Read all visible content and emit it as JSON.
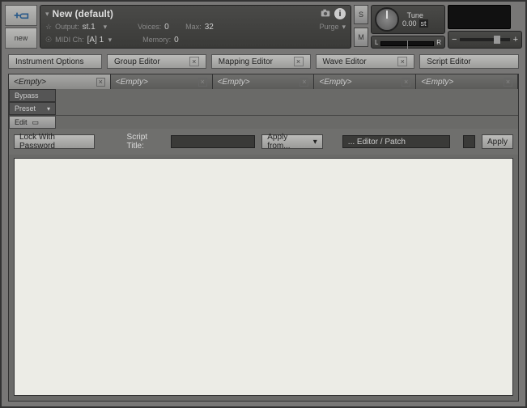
{
  "header": {
    "tool_new_label": "new",
    "title": "New (default)",
    "output_label": "Output:",
    "output_value": "st.1",
    "midi_label": "MIDI Ch:",
    "midi_value": "[A] 1",
    "voices_label": "Voices:",
    "voices_value": "0",
    "voices_max_label": "Max:",
    "voices_max_value": "32",
    "memory_label": "Memory:",
    "memory_value": "0",
    "purge_label": "Purge",
    "s_btn": "S",
    "m_btn": "M",
    "tune_label": "Tune",
    "tune_value": "0.00",
    "tune_unit": "st",
    "meter_l": "L",
    "meter_r": "R",
    "vol_minus": "−",
    "vol_plus": "+"
  },
  "editors": {
    "instrument": "Instrument Options",
    "group": "Group Editor",
    "mapping": "Mapping Editor",
    "wave": "Wave Editor",
    "script": "Script Editor"
  },
  "tabs": [
    "<Empty>",
    "<Empty>",
    "<Empty>",
    "<Empty>",
    "<Empty>"
  ],
  "script_ui": {
    "bypass": "Bypass",
    "preset": "Preset",
    "edit": "Edit",
    "lock": "Lock With Password",
    "title_label": "Script Title:",
    "title_value": "",
    "apply_from": "Apply from...",
    "editor_patch": "... Editor / Patch",
    "apply": "Apply"
  },
  "close": "×"
}
